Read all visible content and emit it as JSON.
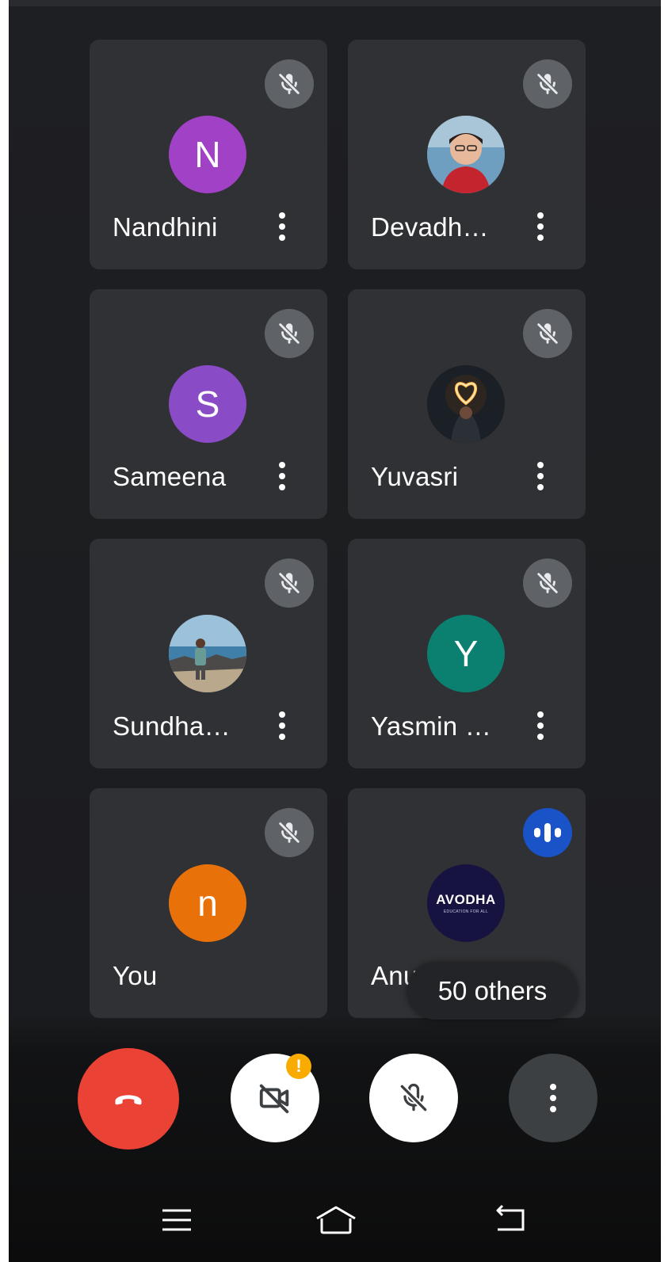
{
  "participants": [
    {
      "name": "Nandhini",
      "avatar_letter": "N",
      "avatar_color": "#a142c6",
      "muted": true
    },
    {
      "name": "Devadh…",
      "avatar_letter": "",
      "avatar_color": "#4a6d8a",
      "muted": true
    },
    {
      "name": "Sameena",
      "avatar_letter": "S",
      "avatar_color": "#8a4bc6",
      "muted": true
    },
    {
      "name": "Yuvasri",
      "avatar_letter": "",
      "avatar_color": "#1c2228",
      "muted": true
    },
    {
      "name": "Sundha…",
      "avatar_letter": "",
      "avatar_color": "#7a9bb0",
      "muted": true
    },
    {
      "name": "Yasmin …",
      "avatar_letter": "Y",
      "avatar_color": "#0b8070",
      "muted": true
    },
    {
      "name": "You",
      "avatar_letter": "n",
      "avatar_color": "#e8710a",
      "muted": true
    },
    {
      "name": "Anu",
      "avatar_letter": "",
      "avatar_color": "#161340",
      "speaking": true,
      "logo_text": "AVODHA",
      "logo_subtext": "EDUCATION FOR ALL"
    }
  ],
  "others_label": "50 others",
  "controls": {
    "end_call_color": "#ea4335",
    "camera_warning": "!",
    "warning_color": "#f9ab00"
  },
  "icons": {
    "mute": "mic-off-icon",
    "speaking": "audio-level-icon",
    "end_call": "phone-hangup-icon",
    "camera_off": "videocam-off-icon",
    "mic_off": "mic-off-icon",
    "more": "more-vert-icon",
    "nav_menu": "menu-icon",
    "nav_home": "home-icon",
    "nav_back": "back-icon"
  }
}
